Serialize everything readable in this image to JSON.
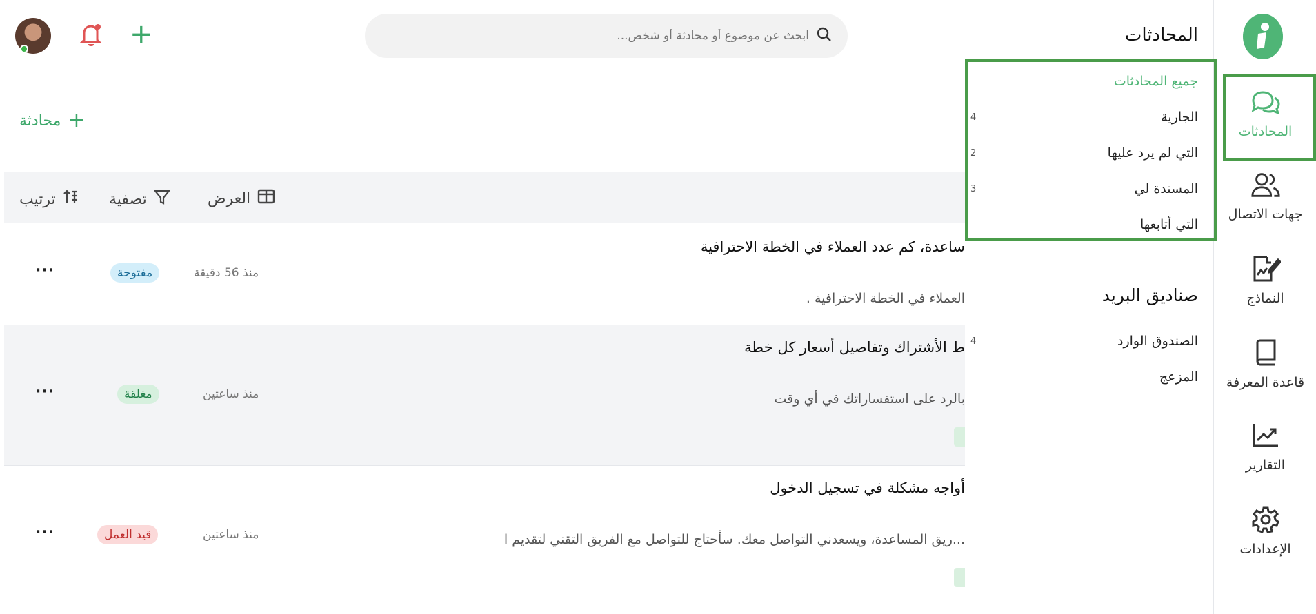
{
  "rail": {
    "items": [
      {
        "label": "المحادثات",
        "icon": "chat-bubbles-icon",
        "active": true
      },
      {
        "label": "جهات الاتصال",
        "icon": "contacts-icon",
        "active": false
      },
      {
        "label": "النماذج",
        "icon": "form-edit-icon",
        "active": false
      },
      {
        "label": "قاعدة المعرفة",
        "icon": "book-icon",
        "active": false
      },
      {
        "label": "التقارير",
        "icon": "chart-trend-icon",
        "active": false
      },
      {
        "label": "الإعدادات",
        "icon": "gear-icon",
        "active": false
      }
    ]
  },
  "panel": {
    "title": "المحادثات",
    "conversations": [
      {
        "label": "جميع المحادثات",
        "count": ""
      },
      {
        "label": "الجارية",
        "count": "4"
      },
      {
        "label": "التي لم يرد عليها",
        "count": "2"
      },
      {
        "label": "المسندة لي",
        "count": "3"
      },
      {
        "label": "التي أتابعها",
        "count": ""
      }
    ],
    "mailboxes_title": "صناديق البريد",
    "mailboxes": [
      {
        "label": "الصندوق الوارد",
        "count": "4"
      },
      {
        "label": "المزعج",
        "count": ""
      }
    ]
  },
  "topbar": {
    "search_placeholder": "ابحث عن موضوع أو محادثة أو شخص..."
  },
  "main": {
    "new_conversation": "محادثة",
    "toolbar": {
      "view": "العرض",
      "filter": "تصفية",
      "sort": "ترتيب"
    },
    "rows": [
      {
        "title": "ساعدة، كم عدد العملاء في الخطة الاحترافية",
        "preview": ". العملاء في الخطة الاحترافية",
        "time": "منذ 56 دقيقة",
        "status": "مفتوحة"
      },
      {
        "title": "ط الأشتراك وتفاصيل أسعار كل خطة",
        "preview": "بالرد على استفساراتك في أي وقت",
        "time": "منذ ساعتين",
        "status": "مغلقة"
      },
      {
        "title": "أواجه مشكلة في تسجيل الدخول",
        "preview": "ريق المساعدة، ويسعدني التواصل معك. سأحتاج للتواصل مع الفريق التقني لتقديم ا...",
        "time": "منذ ساعتين",
        "status": "قيد العمل"
      }
    ],
    "status_colors": {
      "open": "#d3eefa",
      "closed": "#d6f0de",
      "in_progress": "#fbd9d9"
    }
  }
}
